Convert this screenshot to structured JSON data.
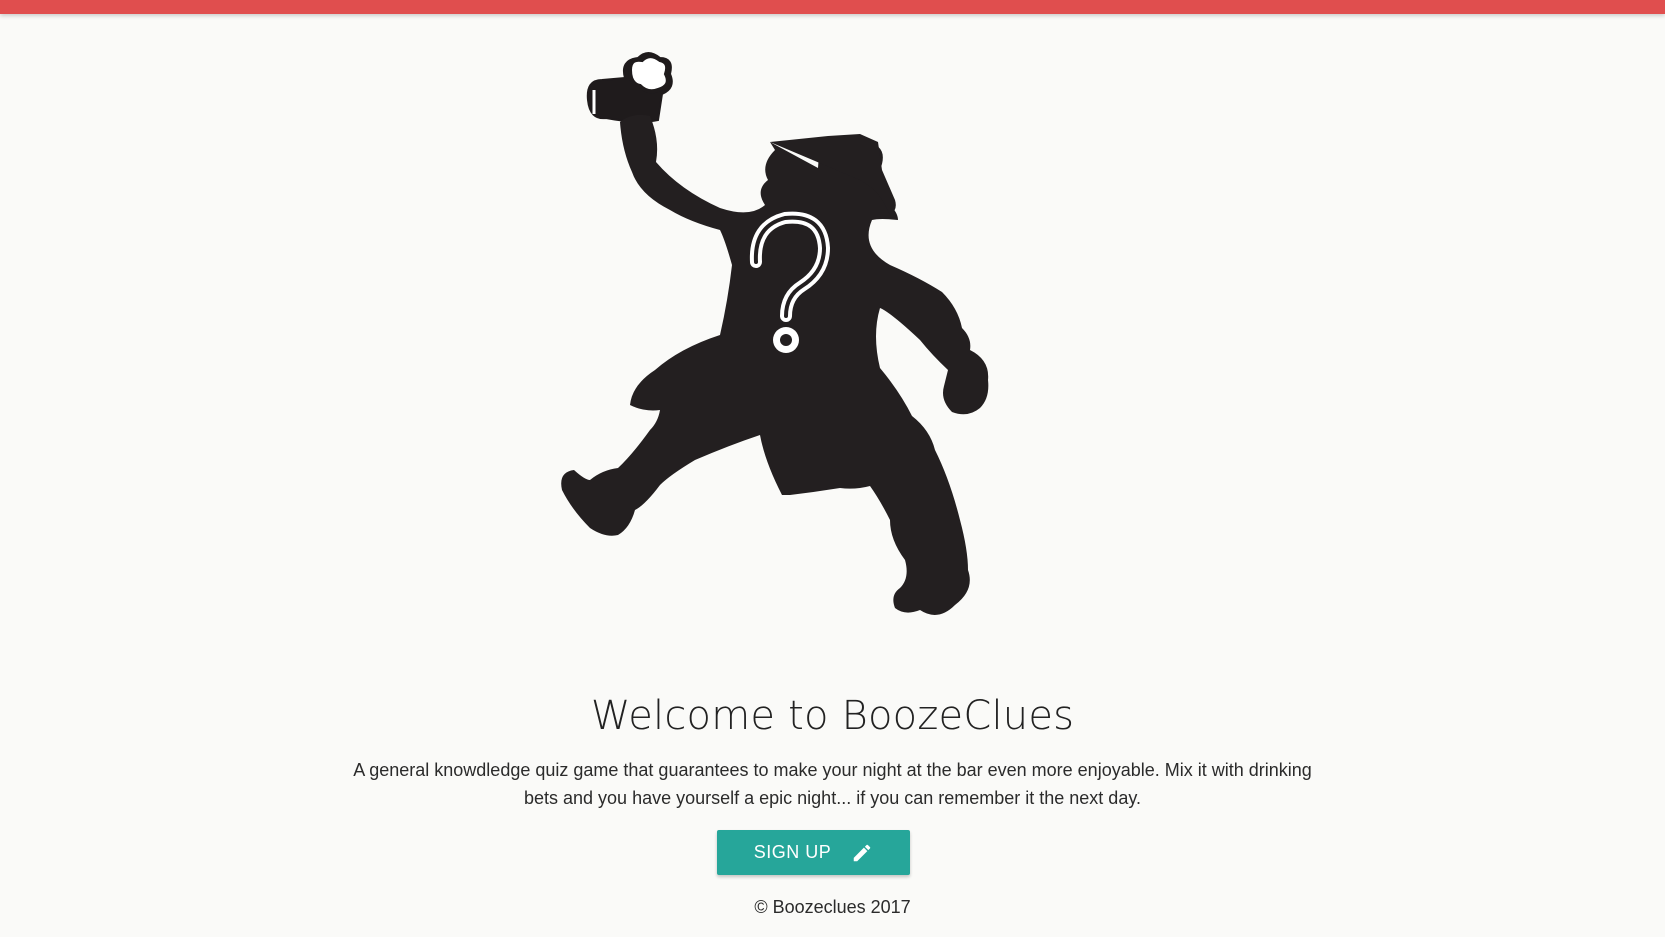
{
  "header": {
    "bar_color": "#e04e4e"
  },
  "hero": {
    "logo_icon": "drinking-man-question-mark-logo-icon",
    "title": "Welcome to BoozeClues",
    "description": "A general knowdledge quiz game that guarantees to make your night at the bar even more enjoyable. Mix it with drinking bets and you have yourself a epic night... if you can remember it the next day.",
    "signup_button": {
      "label": "SIGN UP",
      "icon": "pencil-icon",
      "color": "#26a69a"
    }
  },
  "footer": {
    "copyright": "© Boozeclues 2017"
  }
}
